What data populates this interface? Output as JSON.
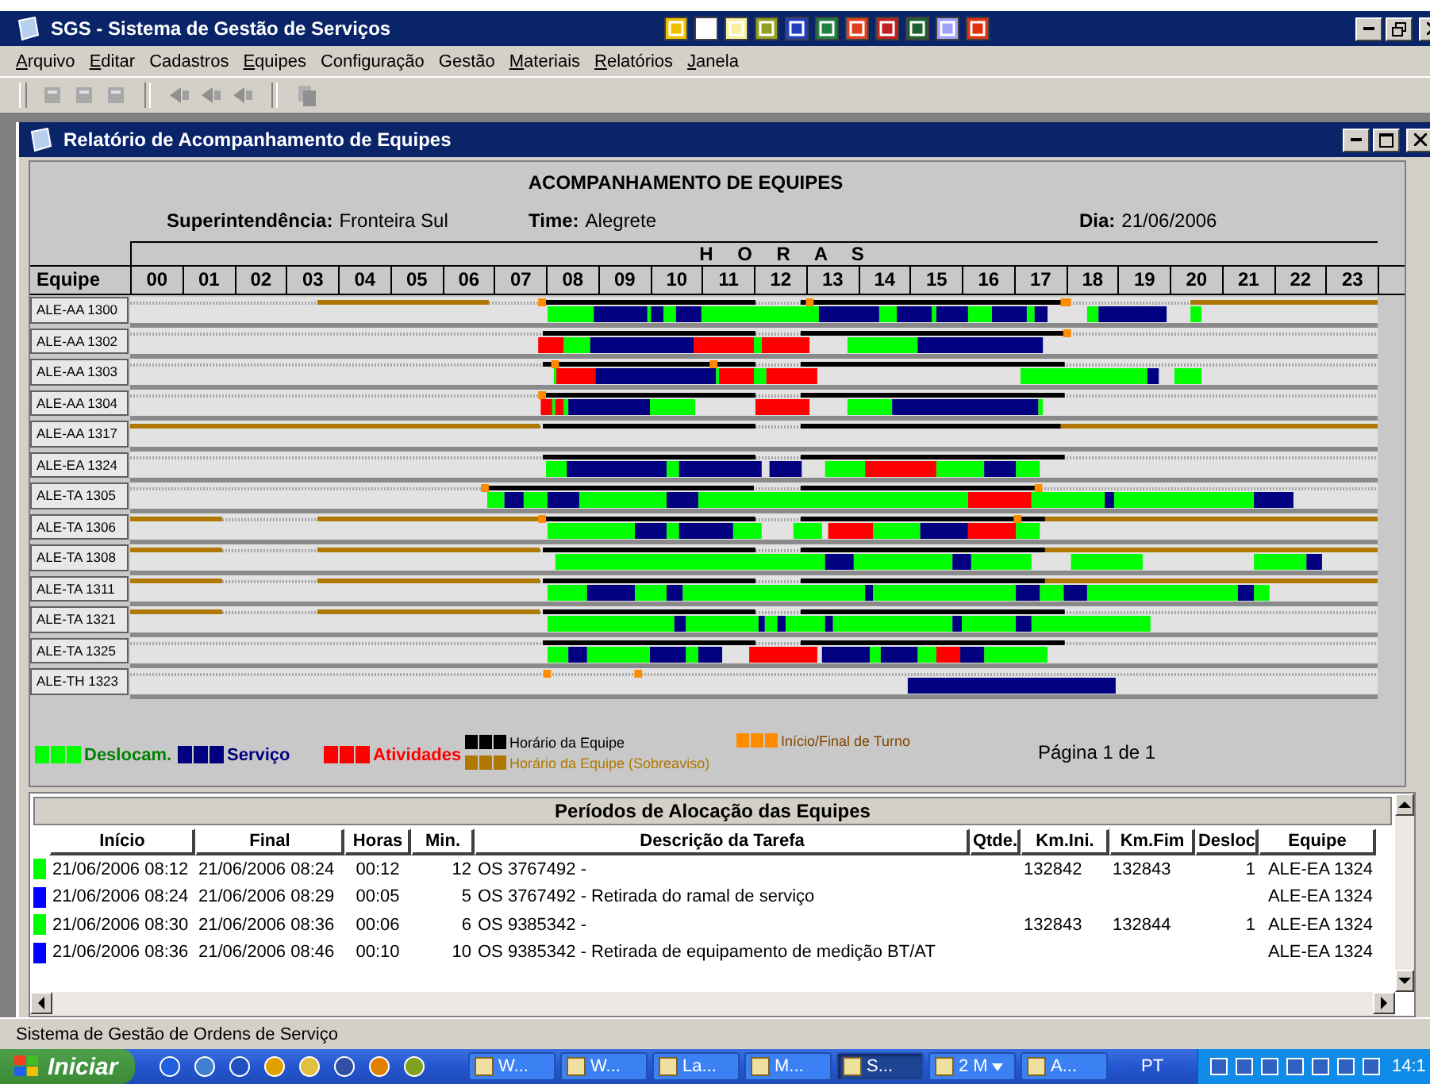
{
  "window": {
    "title": "SGS - Sistema de Gestão de Serviços"
  },
  "menu": [
    {
      "label": "Arquivo",
      "underlined_initial": true
    },
    {
      "label": "Editar",
      "underlined_initial": true
    },
    {
      "label": "Cadastros",
      "underlined_initial": false
    },
    {
      "label": "Equipes",
      "underlined_initial": true
    },
    {
      "label": "Configuração",
      "underlined_initial": false
    },
    {
      "label": "Gestão",
      "underlined_initial": false
    },
    {
      "label": "Materiais",
      "underlined_initial": true
    },
    {
      "label": "Relatórios",
      "underlined_initial": true
    },
    {
      "label": "Janela",
      "underlined_initial": true
    }
  ],
  "child_window": {
    "title": "Relatório de Acompanhamento de Equipes"
  },
  "report": {
    "title": "ACOMPANHAMENTO DE EQUIPES",
    "info": [
      {
        "label": "Superintendência:",
        "value": "Fronteira Sul"
      },
      {
        "label": "Time:",
        "value": "Alegrete"
      },
      {
        "label": "Dia:",
        "value": "21/06/2006"
      }
    ],
    "hours_title": "H O R A S",
    "team_header": "Equipe",
    "hours": [
      "00",
      "01",
      "02",
      "03",
      "04",
      "05",
      "06",
      "07",
      "08",
      "09",
      "10",
      "11",
      "12",
      "13",
      "14",
      "15",
      "16",
      "17",
      "18",
      "19",
      "20",
      "21",
      "22",
      "23"
    ],
    "teams": [
      "ALE-AA 1300",
      "ALE-AA 1302",
      "ALE-AA 1303",
      "ALE-AA 1304",
      "ALE-AA 1317",
      "ALE-EA 1324",
      "ALE-TA 1305",
      "ALE-TA 1306",
      "ALE-TA 1308",
      "ALE-TA 1311",
      "ALE-TA 1321",
      "ALE-TA 1325",
      "ALE-TH 1323"
    ],
    "legend": [
      {
        "label": "Deslocam.",
        "kind": "bar",
        "color": "#00ff00"
      },
      {
        "label": "Serviço",
        "kind": "bar",
        "color": "#000080"
      },
      {
        "label": "Atividades",
        "kind": "bar",
        "color": "#ff0000"
      },
      {
        "label": "Horário da Equipe",
        "kind": "line",
        "color": "#000000"
      },
      {
        "label": "Horário da Equipe (Sobreaviso)",
        "kind": "line",
        "color": "#b07800"
      },
      {
        "label": "Início/Final de Turno",
        "kind": "mark",
        "color": "#ff8c00"
      }
    ],
    "page": "Página 1 de 1"
  },
  "allocation": {
    "title": "Períodos de Alocação das Equipes",
    "columns": [
      "Início",
      "Final",
      "Horas",
      "Min.",
      "Descrição da Tarefa",
      "Qtde.",
      "Km.Ini.",
      "Km.Fim",
      "Desloc",
      "Equipe"
    ],
    "rows": [
      {
        "color": "#00ff00",
        "start": "21/06/2006 08:12",
        "end": "21/06/2006 08:24",
        "hours": "00:12",
        "minutes": "12",
        "description": "OS 3767492 -",
        "km_start": "132842",
        "km_end": "132843",
        "desloc": "1",
        "team": "ALE-EA 1324"
      },
      {
        "color": "#0000ff",
        "start": "21/06/2006 08:24",
        "end": "21/06/2006 08:29",
        "hours": "00:05",
        "minutes": "5",
        "description": "OS 3767492 - Retirada do ramal de serviço",
        "team": "ALE-EA 1324"
      },
      {
        "color": "#00ff00",
        "start": "21/06/2006 08:30",
        "end": "21/06/2006 08:36",
        "hours": "00:06",
        "minutes": "6",
        "description": "OS 9385342 -",
        "km_start": "132843",
        "km_end": "132844",
        "desloc": "1",
        "team": "ALE-EA 1324"
      },
      {
        "color": "#0000ff",
        "start": "21/06/2006 08:36",
        "end": "21/06/2006 08:46",
        "hours": "00:10",
        "minutes": "10",
        "description": "OS 9385342 - Retirada de equipamento de medição BT/AT",
        "team": "ALE-EA 1324"
      }
    ]
  },
  "status_bar": "Sistema de Gestão de Ordens de Serviço",
  "taskbar": {
    "start": "Iniciar",
    "tasks": [
      {
        "label": "W...",
        "kind": "plain",
        "selected": false
      },
      {
        "label": "W...",
        "kind": "plain",
        "selected": false
      },
      {
        "label": "La...",
        "kind": "plain",
        "selected": false
      },
      {
        "label": "M...",
        "kind": "plain",
        "selected": false
      },
      {
        "label": "S...",
        "kind": "plain",
        "selected": true
      },
      {
        "label": "2 M",
        "kind": "group",
        "selected": false
      },
      {
        "label": "A...",
        "kind": "plain",
        "selected": false
      }
    ],
    "language": "PT",
    "clock": "14:1"
  }
}
